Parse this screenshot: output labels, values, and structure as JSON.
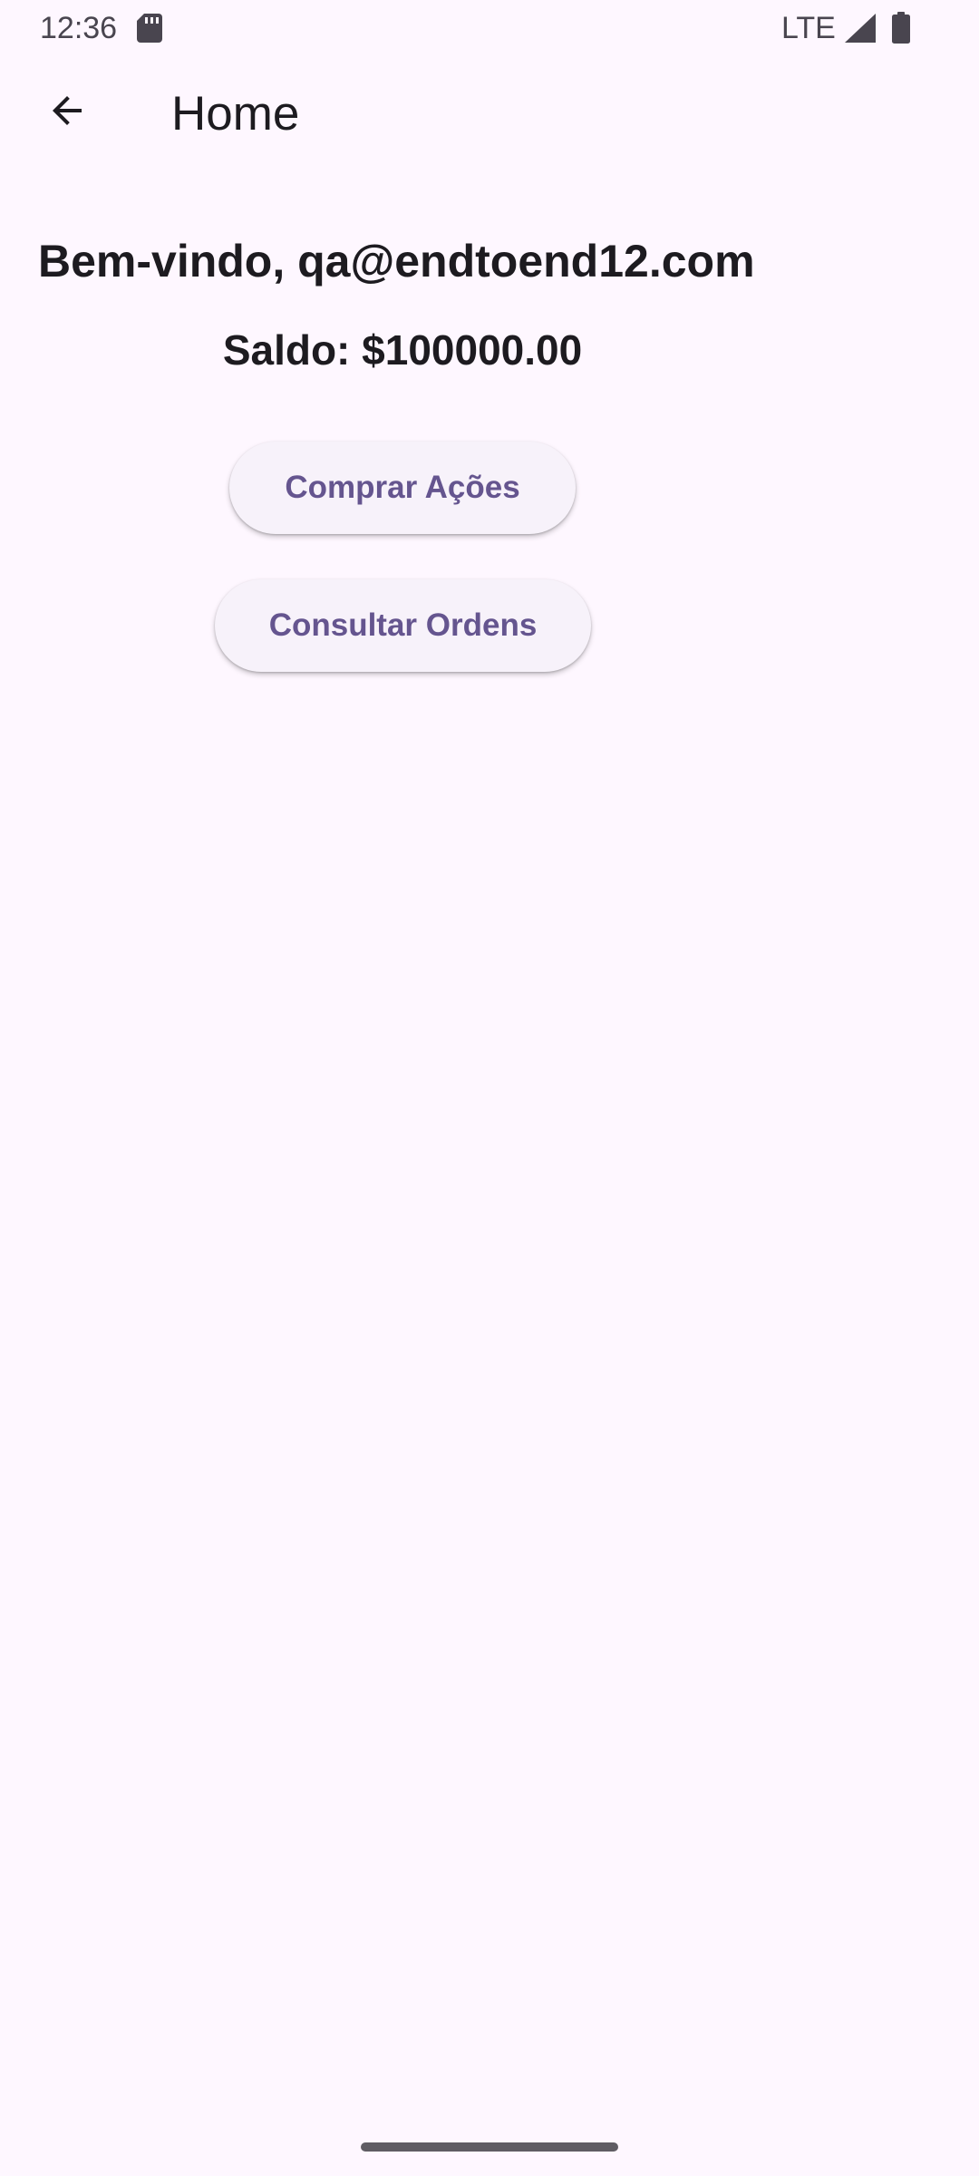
{
  "status_bar": {
    "time": "12:36",
    "network": "LTE",
    "icons": [
      "sd-card-icon",
      "signal-icon",
      "battery-icon"
    ]
  },
  "app_bar": {
    "title": "Home",
    "back_icon": "arrow-back-icon"
  },
  "content": {
    "welcome": "Bem-vindo, qa@endtoend12.com",
    "balance": "Saldo: $100000.00",
    "buy_button": "Comprar Ações",
    "orders_button": "Consultar Ordens"
  },
  "colors": {
    "background": "#FEF7FF",
    "button_background": "#F7F2FA",
    "accent": "#65558F",
    "text": "#1D1B20"
  }
}
